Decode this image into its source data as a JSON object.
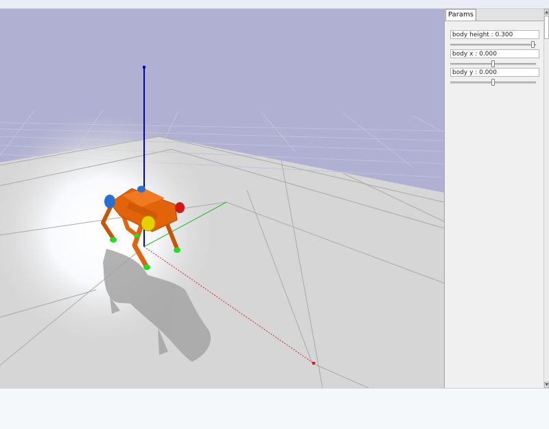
{
  "params_panel": {
    "tab_label": "Params",
    "params": [
      {
        "label": "body height",
        "value": "0.300",
        "slider_fraction": 0.97
      },
      {
        "label": "body x",
        "value": "0.000",
        "slider_fraction": 0.5
      },
      {
        "label": "body y",
        "value": "0.000",
        "slider_fraction": 0.5
      }
    ]
  },
  "scene": {
    "sky_color": "#b0b0d2",
    "floor_color": "#d6d6d6",
    "robot_color": "#e3630a",
    "axis_colors": {
      "x": "#cc2222",
      "y": "#22bb22",
      "z": "#0000cc"
    }
  },
  "icons": {
    "scroll_up": "▲",
    "scroll_down": "▼"
  }
}
